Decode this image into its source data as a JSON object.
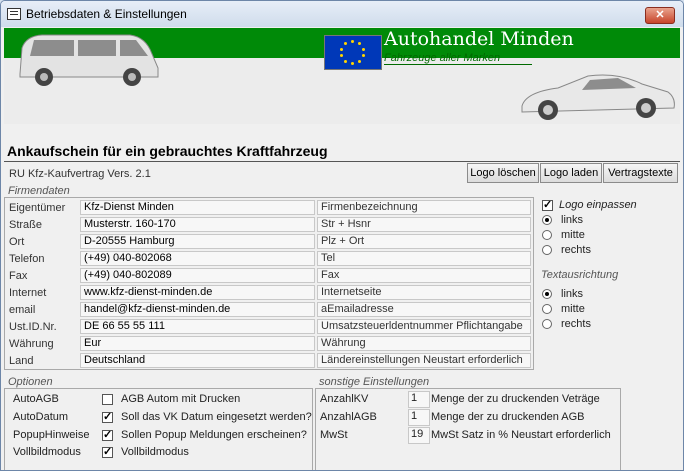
{
  "window": {
    "title": "Betriebsdaten  & Einstellungen",
    "close": "✕"
  },
  "banner": {
    "brand": "Autohandel Minden",
    "tagline": "Fahrzeuge aller Marken"
  },
  "heading": "Ankaufschein für ein gebrauchtes Kraftfahrzeug",
  "version": "RU Kfz-Kaufvertrag  Vers. 2.1",
  "buttons": {
    "logo_delete": "Logo löschen",
    "logo_load": "Logo laden",
    "contract_texts": "Vertragstexte"
  },
  "firmendaten": {
    "label": "Firmendaten",
    "rows": [
      {
        "label": "Eigentümer",
        "value": "Kfz-Dienst Minden",
        "desc": "Firmenbezeichnung"
      },
      {
        "label": "Straße",
        "value": "Musterstr. 160-170",
        "desc": "Str + Hsnr"
      },
      {
        "label": "Ort",
        "value": "D-20555 Hamburg",
        "desc": "Plz + Ort"
      },
      {
        "label": "Telefon",
        "value": "(+49) 040-802068",
        "desc": "Tel"
      },
      {
        "label": "Fax",
        "value": "(+49) 040-802089",
        "desc": "Fax"
      },
      {
        "label": "Internet",
        "value": "www.kfz-dienst-minden.de",
        "desc": "Internetseite"
      },
      {
        "label": "email",
        "value": "handel@kfz-dienst-minden.de",
        "desc": "aEmailadresse"
      },
      {
        "label": "Ust.ID.Nr.",
        "value": "DE 66 55 55 111",
        "desc": "Umsatzsteuerldentnummer Pflichtangabe"
      },
      {
        "label": "Währung",
        "value": "Eur",
        "desc": "Währung"
      },
      {
        "label": "Land",
        "value": "Deutschland",
        "desc": "Ländereinstellungen Neustart erforderlich"
      }
    ]
  },
  "logo": {
    "fit_label": "Logo einpassen",
    "fit_checked": true,
    "options": [
      {
        "label": "links",
        "selected": true
      },
      {
        "label": "mitte",
        "selected": false
      },
      {
        "label": "rechts",
        "selected": false
      }
    ]
  },
  "textalign": {
    "label": "Textausrichtung",
    "options": [
      {
        "label": "links",
        "selected": true
      },
      {
        "label": "mitte",
        "selected": false
      },
      {
        "label": "rechts",
        "selected": false
      }
    ]
  },
  "optionen": {
    "label": "Optionen",
    "rows": [
      {
        "label": "AutoAGB",
        "checked": false,
        "text": "AGB Autom mit Drucken"
      },
      {
        "label": "AutoDatum",
        "checked": true,
        "text": "Soll das VK Datum eingesetzt werden?"
      },
      {
        "label": "PopupHinweise",
        "checked": true,
        "text": "Sollen Popup Meldungen erscheinen?"
      },
      {
        "label": "Vollbildmodus",
        "checked": true,
        "text": "Vollbildmodus"
      }
    ]
  },
  "sonstige": {
    "label": "sonstige Einstellungen",
    "rows": [
      {
        "label": "AnzahlKV",
        "value": "1",
        "text": "Menge der zu druckenden Veträge"
      },
      {
        "label": "AnzahlAGB",
        "value": "1",
        "text": "Menge der zu druckenden AGB"
      },
      {
        "label": "MwSt",
        "value": "19",
        "text": "MwSt Satz in % Neustart erforderlich"
      }
    ]
  }
}
